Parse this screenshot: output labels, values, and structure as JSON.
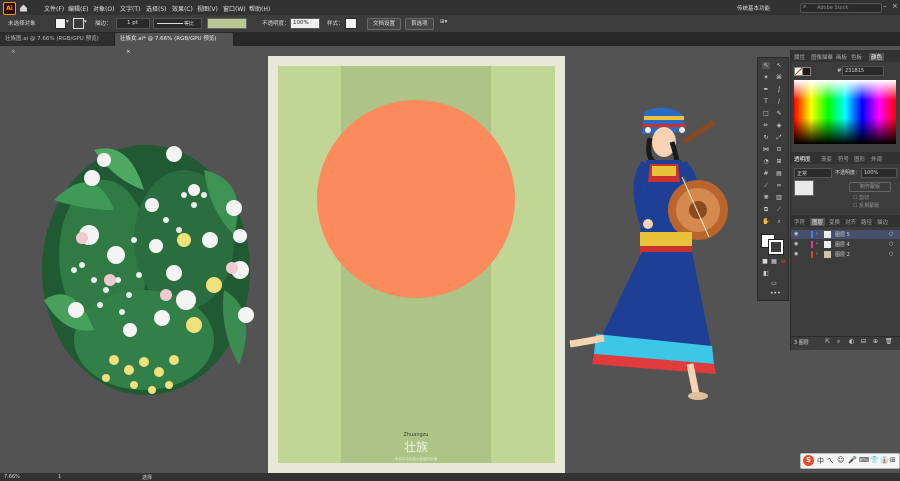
{
  "app": {
    "logo": "Ai"
  },
  "menu": {
    "items": [
      "文件(F)",
      "编辑(E)",
      "对象(O)",
      "文字(T)",
      "选择(S)",
      "效果(C)",
      "视图(V)",
      "窗口(W)",
      "帮助(H)"
    ]
  },
  "workspace": {
    "label": "传统基本功能",
    "search_placeholder": "Adobe Stock"
  },
  "control_bar": {
    "selection_status": "未选择对象",
    "stroke_label": "描边：",
    "stroke_value": "1 pt",
    "stroke_style": "等比",
    "opacity_label": "不透明度：",
    "opacity_value": "100%",
    "style_label": "样式：",
    "doc_setup_button": "文档设置",
    "preferences_button": "首选项"
  },
  "tabs": [
    {
      "label": "壮族图.ai @ 7.66% (RGB/GPU 预览)",
      "close": "×"
    },
    {
      "label": "壮族女.ai* @ 7.66% (RGB/GPU 预览)",
      "close": "×"
    }
  ],
  "artwork": {
    "pinyin": "Zhuangzu",
    "title": "壮族",
    "subtitle": "来自中华民族大家庭的祝福"
  },
  "color_panel": {
    "tabs": [
      "属性",
      "图像描摹",
      "画板",
      "色板",
      "颜色"
    ],
    "hex": "231815"
  },
  "transparency_panel": {
    "tabs": [
      "透明度",
      "渐变",
      "符号",
      "图形",
      "外观"
    ],
    "blend_mode": "正常",
    "opacity_label": "不透明度：",
    "opacity_value": "100%",
    "make_mask_button": "制作蒙版",
    "clip_label": "剪切",
    "invert_label": "反相蒙版"
  },
  "layers_panel": {
    "tabs": [
      "字符",
      "图层",
      "变换",
      "对齐",
      "路径",
      "描边"
    ],
    "layers": [
      "图层 5",
      "图层 4",
      "图层 2"
    ],
    "footer_count": "3 图层"
  },
  "status_bar": {
    "zoom": "7.66%",
    "page": "1",
    "tool": "选择"
  },
  "system_tray": {
    "items": [
      "S",
      "中",
      "ㄟ",
      "☺",
      "🎤",
      "⌨",
      "👕",
      "👔",
      "⊞"
    ]
  }
}
